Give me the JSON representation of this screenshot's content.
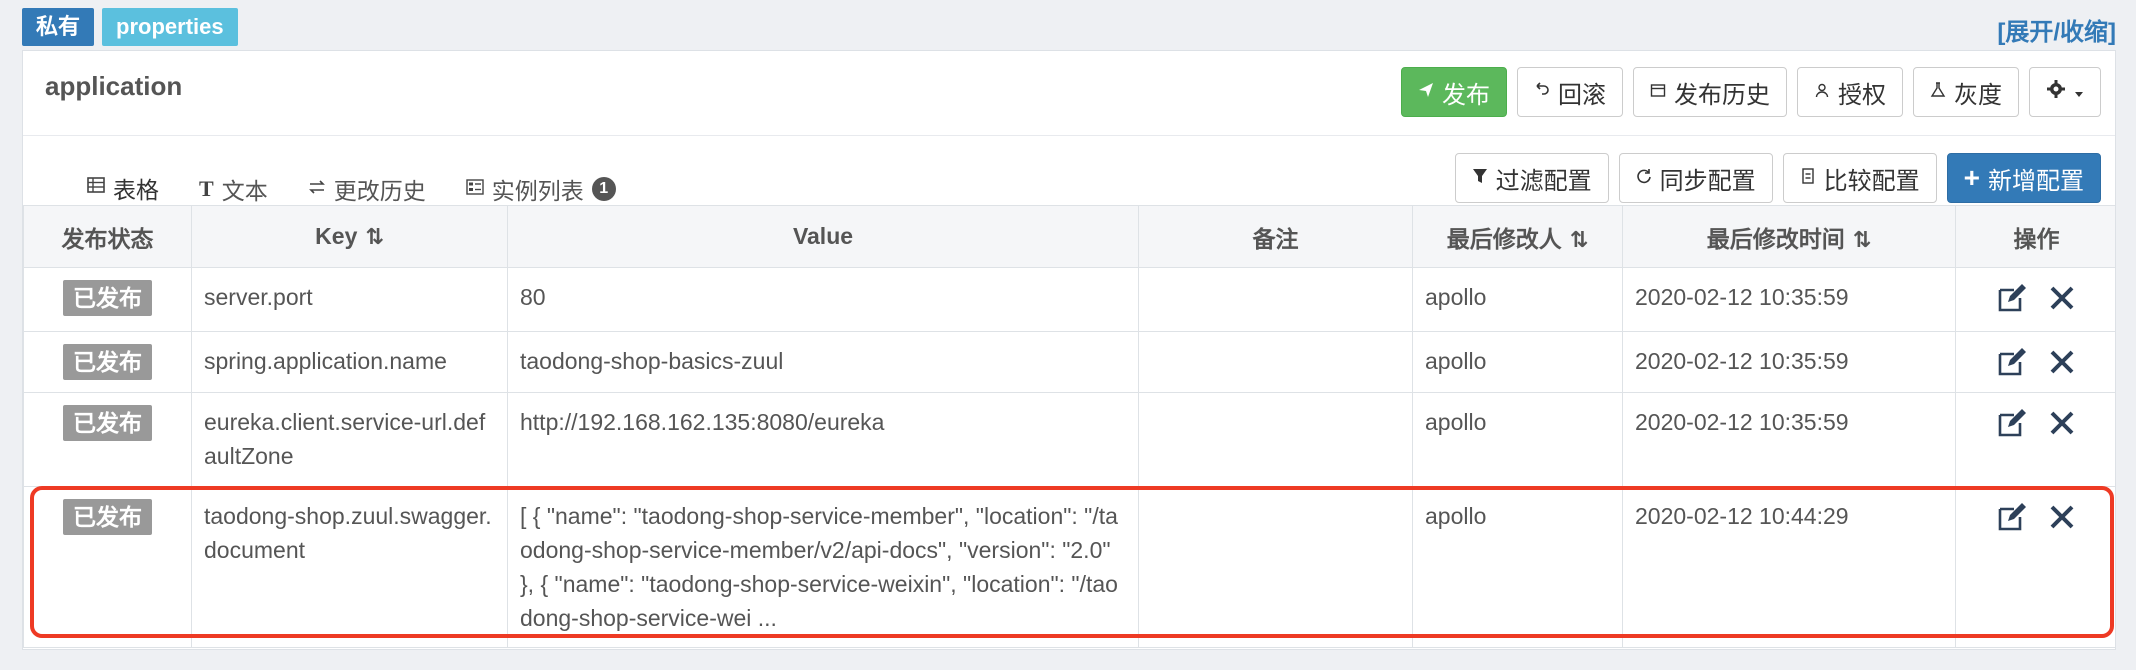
{
  "header": {
    "badge_private": "私有",
    "badge_format": "properties",
    "expand_link": "[展开/收缩]"
  },
  "namespace": {
    "title": "application"
  },
  "toolbar": {
    "publish": "发布",
    "rollback": "回滚",
    "history": "发布历史",
    "authorize": "授权",
    "gray": "灰度"
  },
  "tabs": [
    {
      "label": "表格"
    },
    {
      "label": "文本"
    },
    {
      "label": "更改历史"
    },
    {
      "label": "实例列表",
      "count": "1"
    }
  ],
  "actions": {
    "filter": "过滤配置",
    "sync": "同步配置",
    "compare": "比较配置",
    "add": "新增配置"
  },
  "table": {
    "headers": [
      "发布状态",
      "Key",
      "Value",
      "备注",
      "最后修改人",
      "最后修改时间",
      "操作"
    ],
    "rows": [
      {
        "status": "已发布",
        "key": "server.port",
        "value": "80",
        "comment": "",
        "modifier": "apollo",
        "time": "2020-02-12 10:35:59"
      },
      {
        "status": "已发布",
        "key": "spring.application.name",
        "value": "taodong-shop-basics-zuul",
        "comment": "",
        "modifier": "apollo",
        "time": "2020-02-12 10:35:59"
      },
      {
        "status": "已发布",
        "key": "eureka.client.service-url.defaultZone",
        "value": "http://192.168.162.135:8080/eureka",
        "comment": "",
        "modifier": "apollo",
        "time": "2020-02-12 10:35:59"
      },
      {
        "status": "已发布",
        "key": "taodong-shop.zuul.swagger.document",
        "value": "[ { \"name\": \"taodong-shop-service-member\", \"location\": \"/taodong-shop-service-member/v2/api-docs\", \"version\": \"2.0\" }, { \"name\": \"taodong-shop-service-weixin\", \"location\": \"/taodong-shop-service-wei ...",
        "comment": "",
        "modifier": "apollo",
        "time": "2020-02-12 10:44:29"
      }
    ]
  },
  "colors": {
    "success": "#5cb85c",
    "primary": "#337ab7",
    "highlight": "#ee3a24"
  }
}
